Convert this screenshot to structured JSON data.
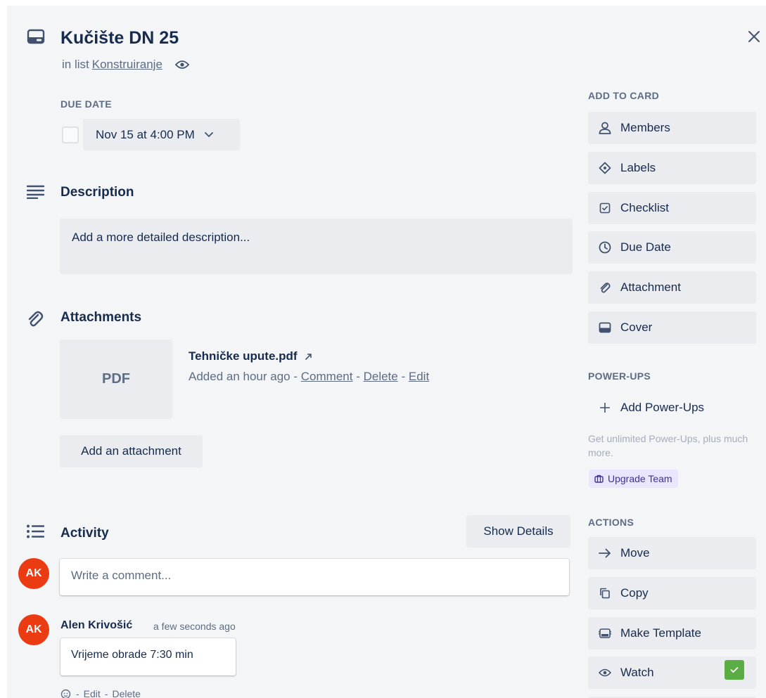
{
  "card": {
    "title": "Kučište DN 25",
    "in_list_prefix": "in list",
    "list_name": "Konstruiranje"
  },
  "due": {
    "heading": "DUE DATE",
    "value": "Nov 15 at 4:00 PM",
    "completed": false
  },
  "description": {
    "title": "Description",
    "placeholder": "Add a more detailed description..."
  },
  "attachments": {
    "title": "Attachments",
    "items": [
      {
        "thumb_label": "PDF",
        "name": "Tehničke upute.pdf",
        "added": "Added an hour ago",
        "sep": "-",
        "comment": "Comment",
        "delete": "Delete",
        "edit": "Edit"
      }
    ],
    "add_label": "Add an attachment"
  },
  "activity": {
    "title": "Activity",
    "show_details": "Show Details",
    "comment_placeholder": "Write a comment...",
    "current_user_initials": "AK",
    "comments": [
      {
        "initials": "AK",
        "author": "Alen Krivošić",
        "time": "a few seconds ago",
        "text": "Vrijeme obrade 7:30 min",
        "sep": "-",
        "edit": "Edit",
        "delete": "Delete"
      }
    ]
  },
  "sidebar": {
    "add_to_card_heading": "ADD TO CARD",
    "add_to_card": [
      {
        "label": "Members",
        "icon": "person-icon"
      },
      {
        "label": "Labels",
        "icon": "tag-icon"
      },
      {
        "label": "Checklist",
        "icon": "checkbox-icon"
      },
      {
        "label": "Due Date",
        "icon": "clock-icon"
      },
      {
        "label": "Attachment",
        "icon": "paperclip-icon"
      },
      {
        "label": "Cover",
        "icon": "card-icon"
      }
    ],
    "power_ups_heading": "POWER-UPS",
    "add_power_ups": "Add Power-Ups",
    "power_ups_text": "Get unlimited Power-Ups, plus much more.",
    "upgrade_label": "Upgrade Team",
    "actions_heading": "ACTIONS",
    "actions": [
      {
        "label": "Move",
        "icon": "arrow-right-icon"
      },
      {
        "label": "Copy",
        "icon": "copy-icon"
      },
      {
        "label": "Make Template",
        "icon": "template-icon"
      },
      {
        "label": "Watch",
        "icon": "eye-icon",
        "checked": true
      }
    ]
  },
  "colors": {
    "panel": "#f4f5f7",
    "button": "#ebecf0",
    "text": "#172b4d",
    "muted": "#5e6c84",
    "avatar": "#eb3b12",
    "watch_check": "#5aac44",
    "upgrade_bg": "#eae6ff",
    "upgrade_text": "#403294"
  }
}
